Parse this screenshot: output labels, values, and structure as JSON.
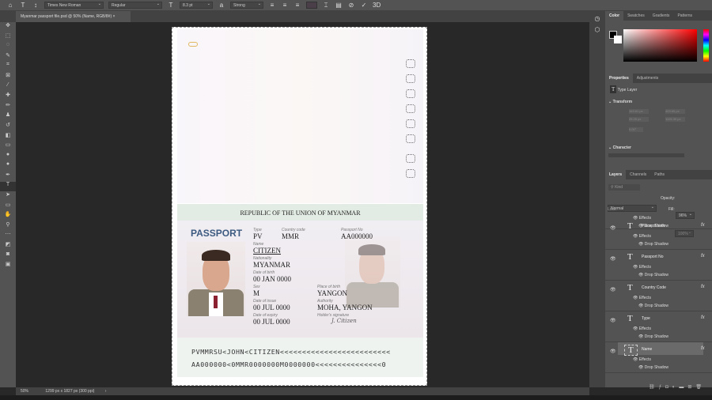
{
  "options_bar": {
    "font_family": "Times New Roman",
    "font_style": "Regular",
    "font_size": "8.3 pt",
    "anti_alias": "Strong",
    "text_color": "#4a3f48"
  },
  "document_tab": {
    "title": "Myanmar passport file.psd @ 50% (Name, RGB/8#)",
    "close": "×"
  },
  "passport": {
    "header": "REPUBLIC OF THE UNION OF MYANMAR",
    "title": "PASSPORT",
    "fields": {
      "type_label": "Type",
      "type": "PV",
      "country_label": "Country code",
      "country": "MMR",
      "passport_no_label": "Passport No",
      "passport_no": "AA000000",
      "name_label": "Name",
      "name": "CITIZEN",
      "nationality_label": "Nationality",
      "nationality": "MYANMAR",
      "dob_label": "Date of birth",
      "dob": "00 JAN 0000",
      "sex_label": "Sex",
      "sex": "M",
      "pob_label": "Place of birth",
      "pob": "YANGON",
      "issue_label": "Date of issue",
      "issue": "00 JUL 0000",
      "authority_label": "Authority",
      "authority": "MOHA, YANGON",
      "expiry_label": "Date of expiry",
      "expiry": "00 JUL 0000",
      "signature_label": "Holder's signature",
      "signature": "J. Citizen"
    },
    "mrz": [
      "PVMMRSU<JOHN<CITIZEN<<<<<<<<<<<<<<<<<<<<<<<<<",
      "AA000000<0MMR0000000M0000000<<<<<<<<<<<<<<<0"
    ]
  },
  "color_panel": {
    "tabs": [
      "Color",
      "Swatches",
      "Gradients",
      "Patterns"
    ],
    "hue": "#ff0000"
  },
  "properties": {
    "tabs": [
      "Properties",
      "Adjustments"
    ],
    "layer_type": "Type Layer",
    "transform": "Transform",
    "w": "163.61 px",
    "x": "403.65 px",
    "h": "25.25 px",
    "y": "1105.30 px",
    "angle": "0.00°",
    "character": "Character"
  },
  "layers_panel": {
    "tabs": [
      "Layers",
      "Channels",
      "Paths"
    ],
    "search": "Kind",
    "blend": "Normal",
    "opacity_label": "Opacity:",
    "opacity": "96%",
    "lock_label": "Lock:",
    "fill_label": "Fill:",
    "fill": "100%",
    "layers": [
      {
        "name": "Place of birth"
      },
      {
        "name": "Passport No"
      },
      {
        "name": "Country Code"
      },
      {
        "name": "Type"
      },
      {
        "name": "Name",
        "selected": true
      }
    ],
    "effects": "Effects",
    "drop_shadow": "Drop Shadow"
  },
  "status": {
    "zoom": "50%",
    "doc_size": "1299 px x 1827 px (300 ppi)"
  }
}
